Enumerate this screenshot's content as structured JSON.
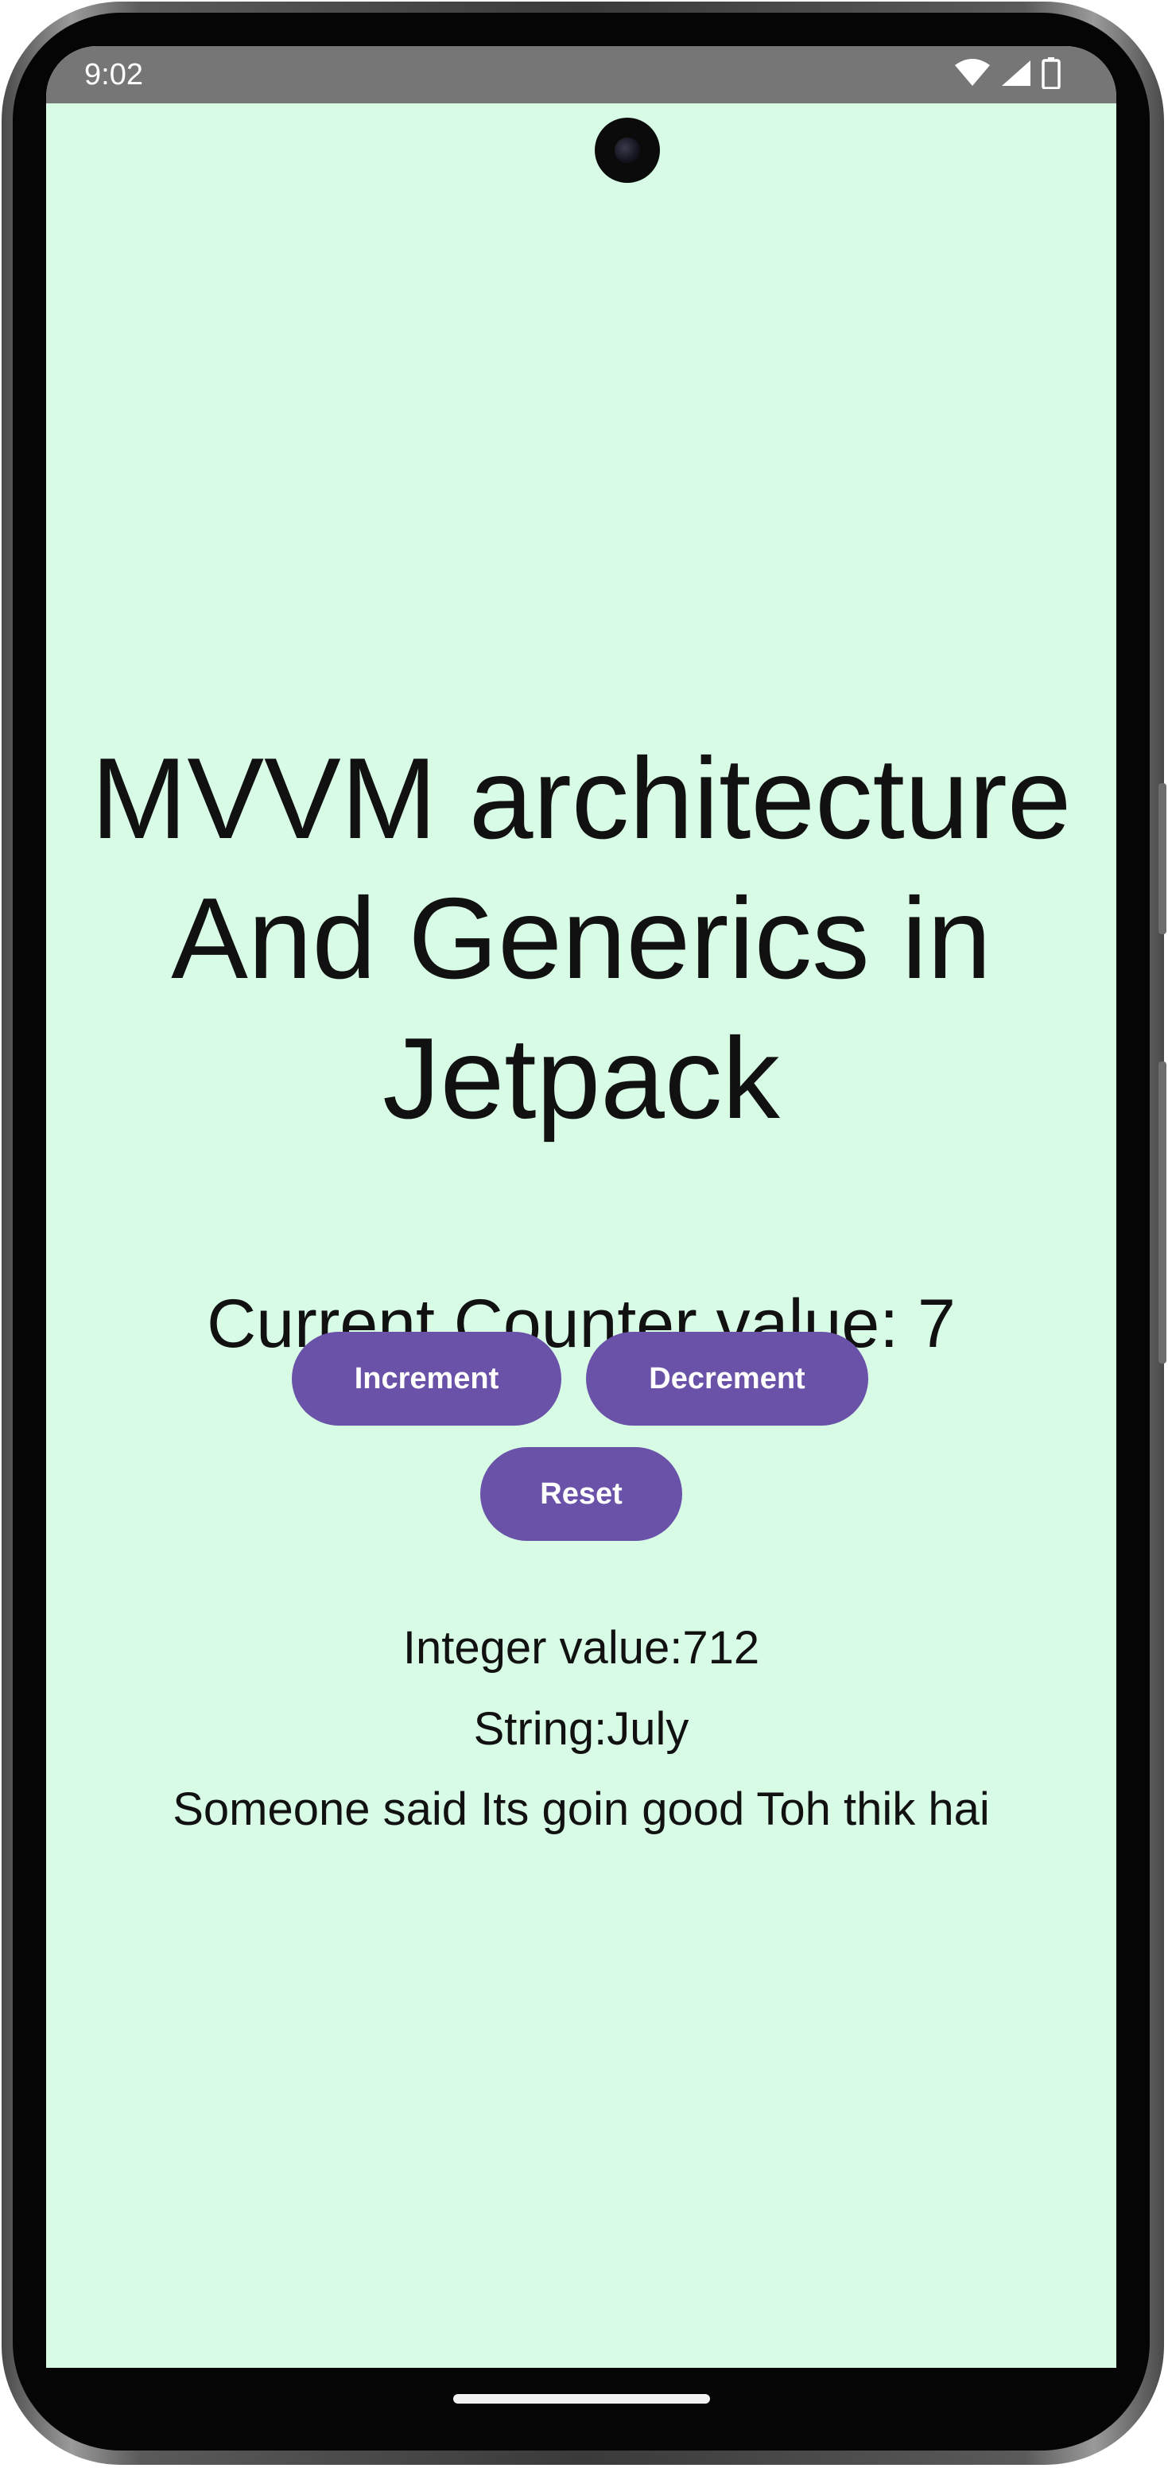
{
  "status_bar": {
    "time": "9:02",
    "icons": [
      "wifi-icon",
      "signal-icon",
      "battery-icon"
    ],
    "background": "#767676"
  },
  "main": {
    "title": "MVVM architecture And Generics in Jetpack",
    "counter_text": "Current Counter value: 7",
    "buttons": {
      "increment": "Increment",
      "decrement": "Decrement",
      "reset": "Reset"
    },
    "integer_text": "Integer value:712",
    "string_text": "String:July",
    "quote_text": "Someone said Its goin good Toh thik hai"
  },
  "colors": {
    "screen_background": "#d8fbe6",
    "button_background": "#6a52a8",
    "button_text": "#ffffff",
    "text": "#111111"
  }
}
